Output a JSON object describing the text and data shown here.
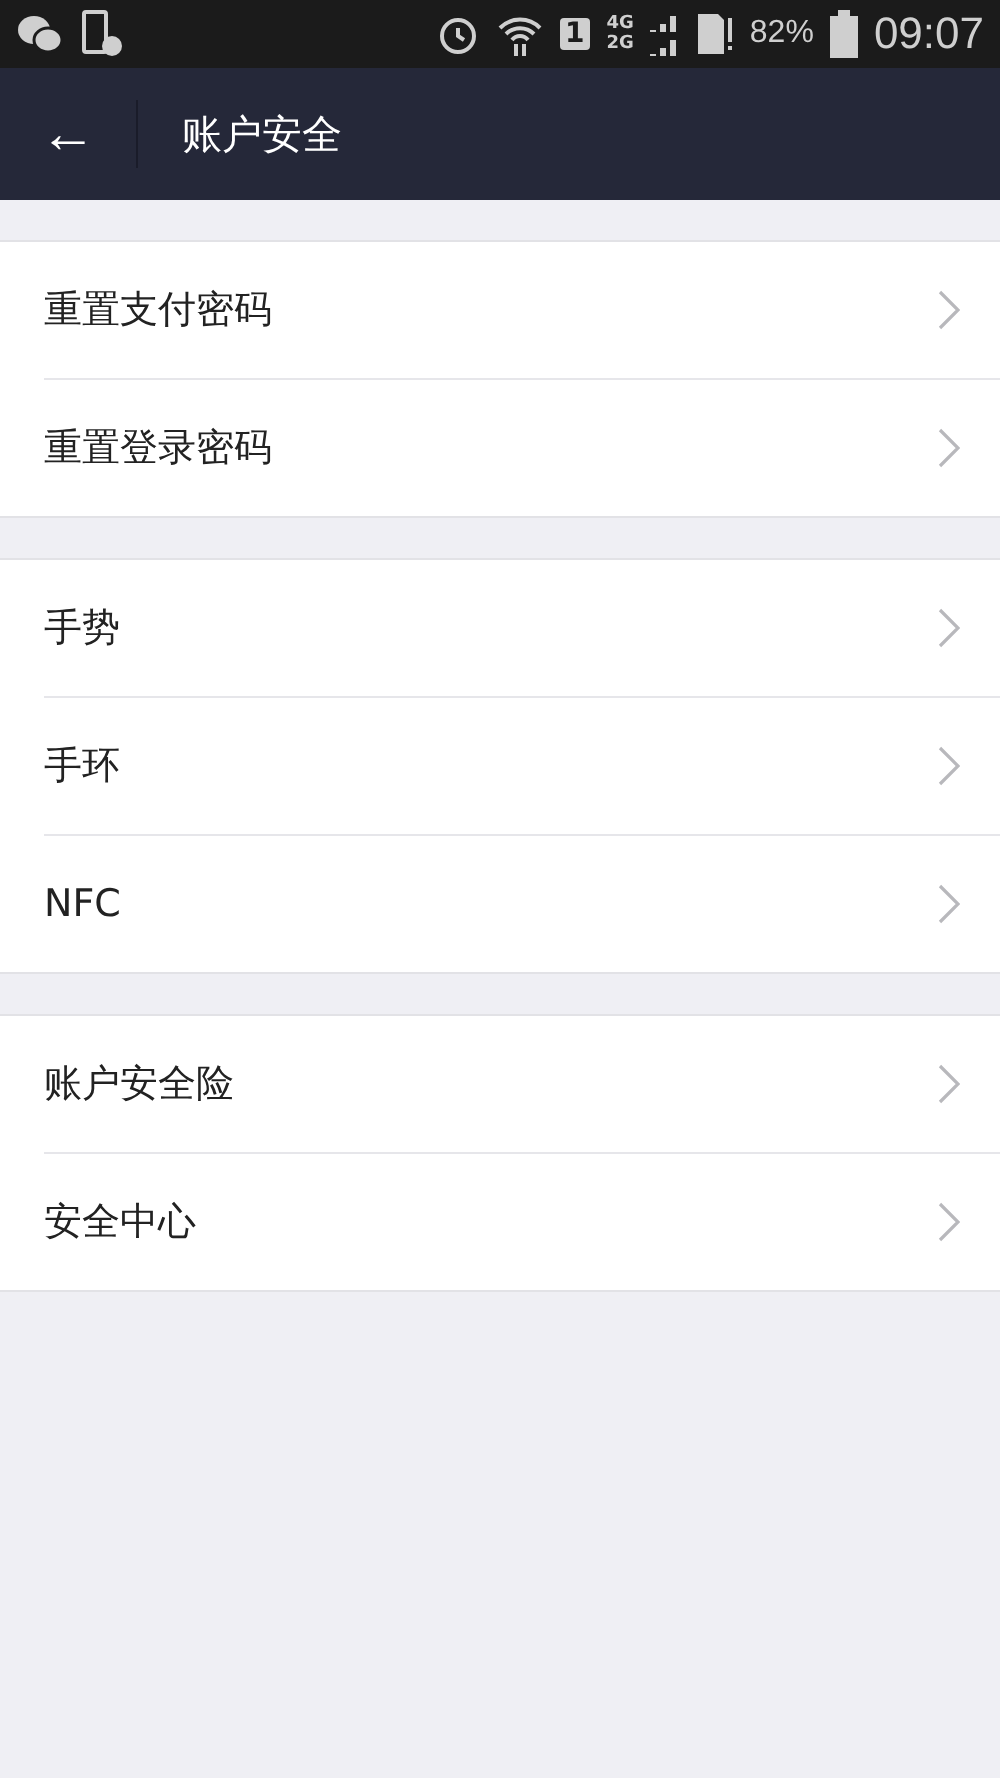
{
  "status_bar": {
    "sim_slot": "1",
    "network_top": "4G",
    "network_bottom": "2G",
    "battery": "82%",
    "time": "09:07"
  },
  "header": {
    "back": "←",
    "title": "账户安全"
  },
  "groups": [
    {
      "items": [
        {
          "label": "重置支付密码"
        },
        {
          "label": "重置登录密码"
        }
      ]
    },
    {
      "items": [
        {
          "label": "手势"
        },
        {
          "label": "手环"
        },
        {
          "label": "NFC"
        }
      ]
    },
    {
      "items": [
        {
          "label": "账户安全险"
        },
        {
          "label": "安全中心"
        }
      ]
    }
  ]
}
